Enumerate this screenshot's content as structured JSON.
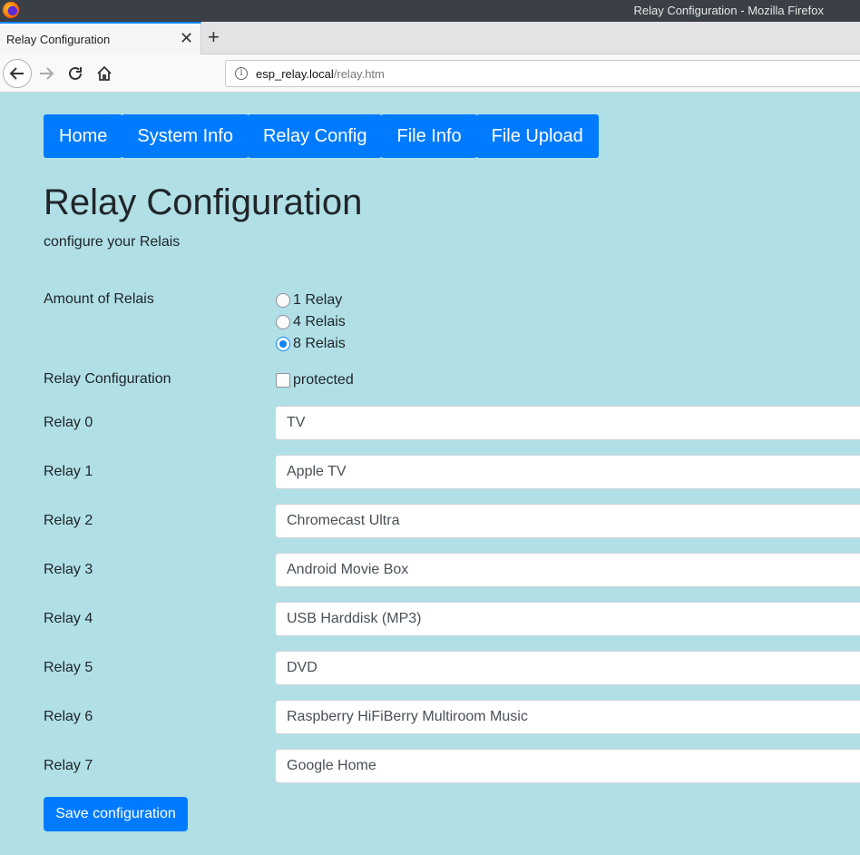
{
  "window": {
    "title": "Relay Configuration - Mozilla Firefox"
  },
  "tab": {
    "title": "Relay Configuration",
    "close_glyph": "✕",
    "new_tab_glyph": "+"
  },
  "address": {
    "host": "esp_relay.local",
    "path": "/relay.htm"
  },
  "nav": [
    {
      "label": "Home"
    },
    {
      "label": "System Info"
    },
    {
      "label": "Relay Config"
    },
    {
      "label": "File Info"
    },
    {
      "label": "File Upload"
    }
  ],
  "page": {
    "title": "Relay Configuration",
    "subtitle": "configure your Relais"
  },
  "amount": {
    "label": "Amount of Relais",
    "options": [
      {
        "label": "1 Relay",
        "checked": false
      },
      {
        "label": "4 Relais",
        "checked": false
      },
      {
        "label": "8 Relais",
        "checked": true
      }
    ]
  },
  "config": {
    "label": "Relay Configuration",
    "checkbox_label": "protected",
    "checked": false
  },
  "relays": [
    {
      "label": "Relay 0",
      "value": "TV"
    },
    {
      "label": "Relay 1",
      "value": "Apple TV"
    },
    {
      "label": "Relay 2",
      "value": "Chromecast Ultra"
    },
    {
      "label": "Relay 3",
      "value": "Android Movie Box"
    },
    {
      "label": "Relay 4",
      "value": "USB Harddisk (MP3)"
    },
    {
      "label": "Relay 5",
      "value": "DVD"
    },
    {
      "label": "Relay 6",
      "value": "Raspberry HiFiBerry Multiroom Music"
    },
    {
      "label": "Relay 7",
      "value": "Google Home"
    }
  ],
  "save_label": "Save configuration",
  "colors": {
    "primary": "#007bff",
    "background": "#b0e0e6"
  }
}
